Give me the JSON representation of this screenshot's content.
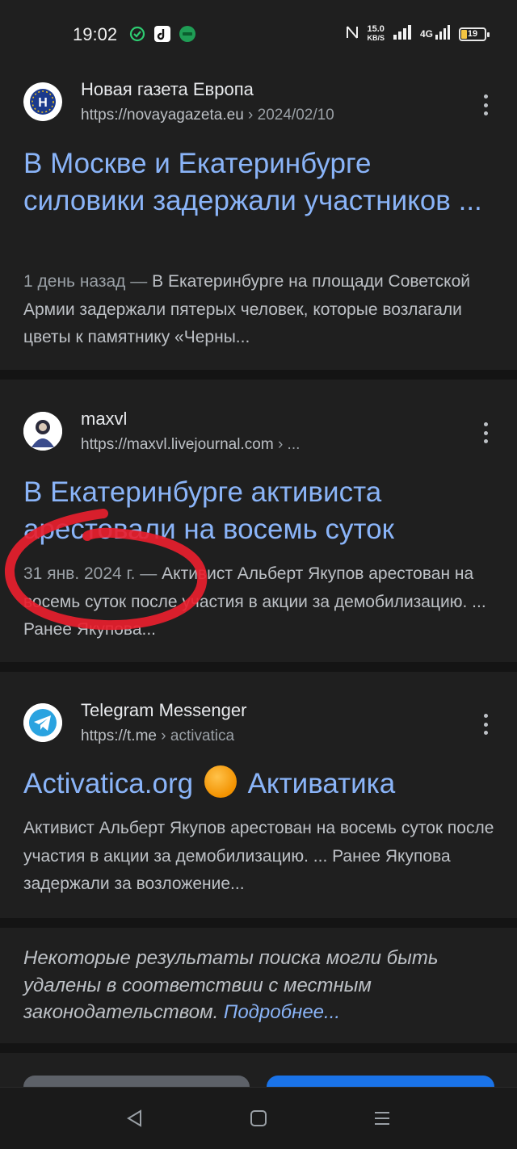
{
  "status_bar": {
    "time": "19:02",
    "speed_value": "15.0",
    "speed_unit": "KB/S",
    "network": "4G",
    "battery": "19",
    "app_icons": [
      "check-circle-icon",
      "music-app-icon",
      "mir-app-icon"
    ]
  },
  "results": [
    {
      "site_name": "Новая газета Европа",
      "url": "https://novayagazeta.eu",
      "url_path": "› 2024/02/10",
      "title": "В Москве и Екатеринбурге силовики задержали участников ...",
      "date": "1 день назад —",
      "snippet": "В Екатеринбурге на площади Советской Армии задержали пятерых человек, которые возлагали цветы к памятнику «Черны..."
    },
    {
      "site_name": "maxvl",
      "url": "https://maxvl.livejournal.com",
      "url_path": "› ...",
      "title": "В Екатеринбурге активиста арестовали на восемь суток",
      "date": "31 янв. 2024 г. —",
      "snippet": "Активист Альберт Якупов арестован на восемь суток после участия в акции за демобилизацию. ... Ранее Якупова..."
    },
    {
      "site_name": "Telegram Messenger",
      "url": "https://t.me",
      "url_path": "› activatica",
      "title_before": "Activatica.org",
      "title_after": "Активатика",
      "snippet": "Активист Альберт Якупов арестован на восемь суток после участия в акции за демобилизацию. ... Ранее Якупова задержали за возложение..."
    }
  ],
  "notice": {
    "text": "Некоторые результаты поиска могли быть удалены в соответствии с местным законодательством.",
    "link": "Подробнее..."
  },
  "colors": {
    "background": "#1f1f1f",
    "title_link": "#8ab4f8",
    "snippet": "#bdc1c6",
    "annotation_red": "#e8202e"
  },
  "nav": [
    "back-icon",
    "home-icon",
    "menu-icon"
  ]
}
